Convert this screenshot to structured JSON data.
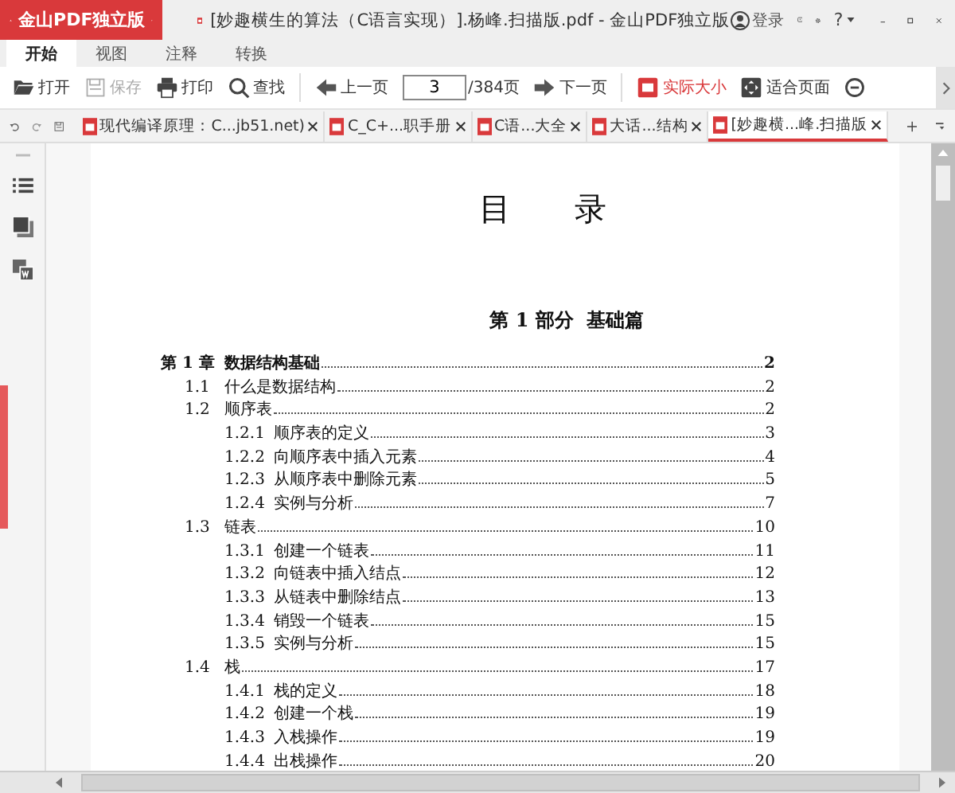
{
  "app": {
    "brand": "金山PDF独立版",
    "title": "[妙趣横生的算法（C语言实现）].杨峰.扫描版.pdf - 金山PDF独立版",
    "login": "登录",
    "help": "?"
  },
  "ribbon_tabs": [
    {
      "label": "开始",
      "selected": true
    },
    {
      "label": "视图",
      "selected": false
    },
    {
      "label": "注释",
      "selected": false
    },
    {
      "label": "转换",
      "selected": false
    }
  ],
  "toolbar": [
    {
      "kind": "button",
      "label": "打开",
      "disabled": false,
      "highlighted": false
    },
    {
      "kind": "button",
      "label": "保存",
      "disabled": true,
      "highlighted": false
    },
    {
      "kind": "button",
      "label": "打印",
      "disabled": false,
      "highlighted": false
    },
    {
      "kind": "button",
      "label": "查找",
      "disabled": false,
      "highlighted": false
    },
    {
      "kind": "separator"
    },
    {
      "kind": "button",
      "label": "上一页",
      "disabled": false,
      "highlighted": false
    },
    {
      "kind": "page",
      "value": "3",
      "total": "/384页"
    },
    {
      "kind": "button",
      "label": "下一页",
      "disabled": false,
      "highlighted": false
    },
    {
      "kind": "separator"
    },
    {
      "kind": "button",
      "label": "实际大小",
      "disabled": false,
      "highlighted": true
    },
    {
      "kind": "button",
      "label": "适合页面",
      "disabled": false,
      "highlighted": false
    },
    {
      "kind": "icon_button"
    }
  ],
  "doc_tabs": [
    {
      "label": "现代编译原理：C...jb51.net)",
      "selected": false
    },
    {
      "label": "C_C+...职手册",
      "selected": false
    },
    {
      "label": "C语...大全",
      "selected": false
    },
    {
      "label": "大话...结构",
      "selected": false
    },
    {
      "label": "[妙趣横...峰.扫描版",
      "selected": true
    }
  ],
  "document": {
    "heading": "目　　录",
    "part_number": "第 1 部分",
    "part_title": "基础篇",
    "toc": [
      {
        "number": "第 1 章",
        "title": "数据结构基础",
        "page": "2",
        "children": [
          {
            "number": "1.1",
            "title": "什么是数据结构",
            "page": "2"
          },
          {
            "number": "1.2",
            "title": "顺序表",
            "page": "2",
            "children": [
              {
                "number": "1.2.1",
                "title": "顺序表的定义",
                "page": "3"
              },
              {
                "number": "1.2.2",
                "title": "向顺序表中插入元素",
                "page": "4"
              },
              {
                "number": "1.2.3",
                "title": "从顺序表中删除元素",
                "page": "5"
              },
              {
                "number": "1.2.4",
                "title": "实例与分析",
                "page": "7"
              }
            ]
          },
          {
            "number": "1.3",
            "title": "链表",
            "page": "10",
            "children": [
              {
                "number": "1.3.1",
                "title": "创建一个链表",
                "page": "11"
              },
              {
                "number": "1.3.2",
                "title": "向链表中插入结点",
                "page": "12"
              },
              {
                "number": "1.3.3",
                "title": "从链表中删除结点",
                "page": "13"
              },
              {
                "number": "1.3.4",
                "title": "销毁一个链表",
                "page": "15"
              },
              {
                "number": "1.3.5",
                "title": "实例与分析",
                "page": "15"
              }
            ]
          },
          {
            "number": "1.4",
            "title": "栈",
            "page": "17",
            "children": [
              {
                "number": "1.4.1",
                "title": "栈的定义",
                "page": "18"
              },
              {
                "number": "1.4.2",
                "title": "创建一个栈",
                "page": "19"
              },
              {
                "number": "1.4.3",
                "title": "入栈操作",
                "page": "19"
              },
              {
                "number": "1.4.4",
                "title": "出栈操作",
                "page": "20"
              }
            ]
          }
        ]
      }
    ]
  }
}
